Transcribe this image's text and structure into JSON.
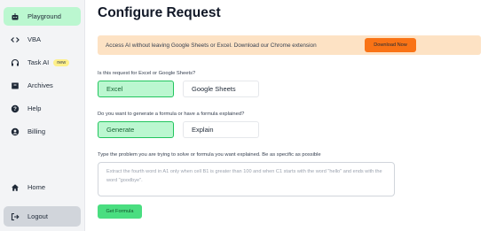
{
  "sidebar": {
    "items": [
      {
        "label": "Playground",
        "icon": "robot-icon"
      },
      {
        "label": "VBA",
        "icon": "code-icon"
      },
      {
        "label": "Task AI",
        "icon": "headphones-icon",
        "badge": "new"
      },
      {
        "label": "Archives",
        "icon": "archive-icon"
      },
      {
        "label": "Help",
        "icon": "question-icon"
      },
      {
        "label": "Billing",
        "icon": "user-icon"
      }
    ],
    "home_label": "Home",
    "logout_label": "Logout"
  },
  "main": {
    "title": "Configure Request",
    "banner": {
      "text": "Access AI without leaving Google Sheets or Excel. Download our Chrome extension",
      "button": "Download Now"
    },
    "q1": {
      "label": "Is this request for Excel or Google Sheets?",
      "options": [
        "Excel",
        "Google Sheets"
      ],
      "selected": "Excel"
    },
    "q2": {
      "label": "Do you want to generate a formula or have a formula explained?",
      "options": [
        "Generate",
        "Explain"
      ],
      "selected": "Generate"
    },
    "q3": {
      "label": "Type the problem you are trying to solve or formula you want explained. Be as specific as possible",
      "placeholder": "Extract the fourth word in A1 only when cell B1 is greater than 100 and when C1 starts with the word \"hello\" and ends with the word \"goodbye\"."
    },
    "submit": "Get Formula"
  },
  "colors": {
    "accent": "#4ade80",
    "selected_bg": "#bbf7d0",
    "banner_bg": "#fde2c4",
    "banner_button": "#f97316"
  }
}
